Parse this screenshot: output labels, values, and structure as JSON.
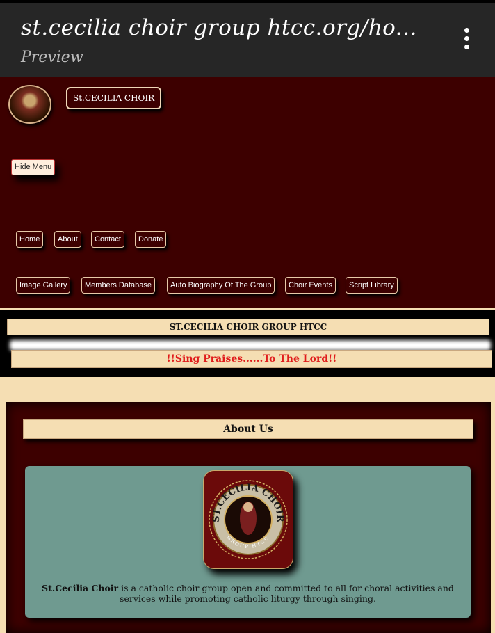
{
  "browser": {
    "title": "st.cecilia choir group htcc.org/ho...",
    "subtitle": "Preview"
  },
  "header": {
    "brand": "St.CECILIA CHOIR",
    "hide_menu": "Hide Menu"
  },
  "nav": {
    "row1": [
      "Home",
      "About",
      "Contact",
      "Donate"
    ],
    "row2": [
      "Image Gallery",
      "Members Database",
      "Auto Biography Of The Group",
      "Choir Events",
      "Script Library"
    ]
  },
  "banner": {
    "group_title": "ST.CECILIA CHOIR GROUP HTCC",
    "tagline": "!!Sing Praises......To The Lord!!"
  },
  "about": {
    "heading": "About Us",
    "badge_top_text": "ST.CECILIA CHOIR",
    "badge_bottom_text": "GROUP HTCC",
    "para_bold": "St.Cecilia Choir",
    "para_rest": " is a catholic choir group open and committed to all for choral activities and services while promoting catholic liturgy through singing."
  },
  "colors": {
    "maroon": "#3d0000",
    "wheat": "#f5deb3",
    "tagline_red": "#e01b1b",
    "card_teal": "#6f9a90"
  }
}
